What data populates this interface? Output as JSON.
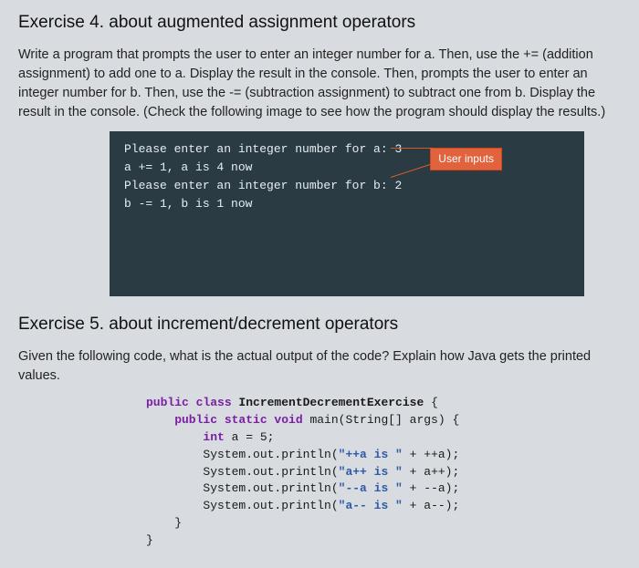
{
  "ex4": {
    "title": "Exercise 4. about augmented assignment operators",
    "body": "Write a program that prompts the user to enter an integer number for a. Then, use the += (addition assignment) to add one to a. Display the result in the console. Then, prompts the user to enter an integer number for b. Then, use the -= (subtraction assignment) to subtract one from b. Display the result in the console. (Check the following image to see how the program should display the results.)",
    "console": {
      "line1": "Please enter an integer number for a: 3",
      "line2": "a += 1, a is 4 now",
      "line3": "Please enter an integer number for b: 2",
      "line4": "b -= 1, b is 1 now",
      "badge": "User inputs"
    }
  },
  "ex5": {
    "title": "Exercise 5. about increment/decrement operators",
    "body": "Given the following code, what is the actual output of the code? Explain how Java gets the printed values.",
    "code": {
      "l1a": "public class ",
      "l1b": "IncrementDecrementExercise",
      "l1c": " {",
      "l2a": "    public static void ",
      "l2b": "main(String[] args)",
      "l2c": " {",
      "l3a": "        int ",
      "l3b": "a = ",
      "l3c": "5",
      "l3d": ";",
      "l4a": "        System.out.println(",
      "l4b": "\"++a is \"",
      "l4c": " + ++a);",
      "l5a": "        System.out.println(",
      "l5b": "\"a++ is \"",
      "l5c": " + a++);",
      "l6a": "        System.out.println(",
      "l6b": "\"--a is \"",
      "l6c": " + --a);",
      "l7a": "        System.out.println(",
      "l7b": "\"a-- is \"",
      "l7c": " + a--);",
      "l8": "    }",
      "l9": "}"
    }
  }
}
